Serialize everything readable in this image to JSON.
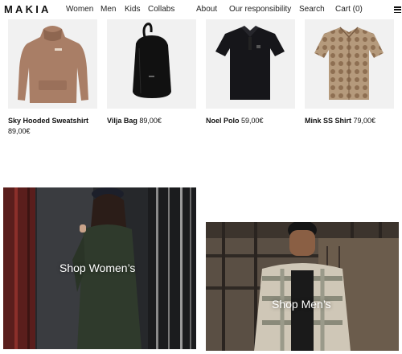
{
  "header": {
    "logo": "MAKIA",
    "nav_left": [
      "Women",
      "Men",
      "Kids",
      "Collabs"
    ],
    "nav_right": [
      "About",
      "Our responsibility",
      "Search",
      "Cart (0)"
    ],
    "menu_icon": "hamburger-menu-icon"
  },
  "products": [
    {
      "name": "Sky Hooded Sweatshirt",
      "price": "89,00€",
      "color": "#a97e66"
    },
    {
      "name": "Vilja Bag",
      "price": "89,00€",
      "color": "#111111"
    },
    {
      "name": "Noel Polo",
      "price": "59,00€",
      "color": "#16161a"
    },
    {
      "name": "Mink SS Shirt",
      "price": "79,00€",
      "color": "#b59a7c"
    }
  ],
  "banners": {
    "women": {
      "label": "Shop Women’s"
    },
    "men": {
      "label": "Shop Men’s"
    }
  }
}
